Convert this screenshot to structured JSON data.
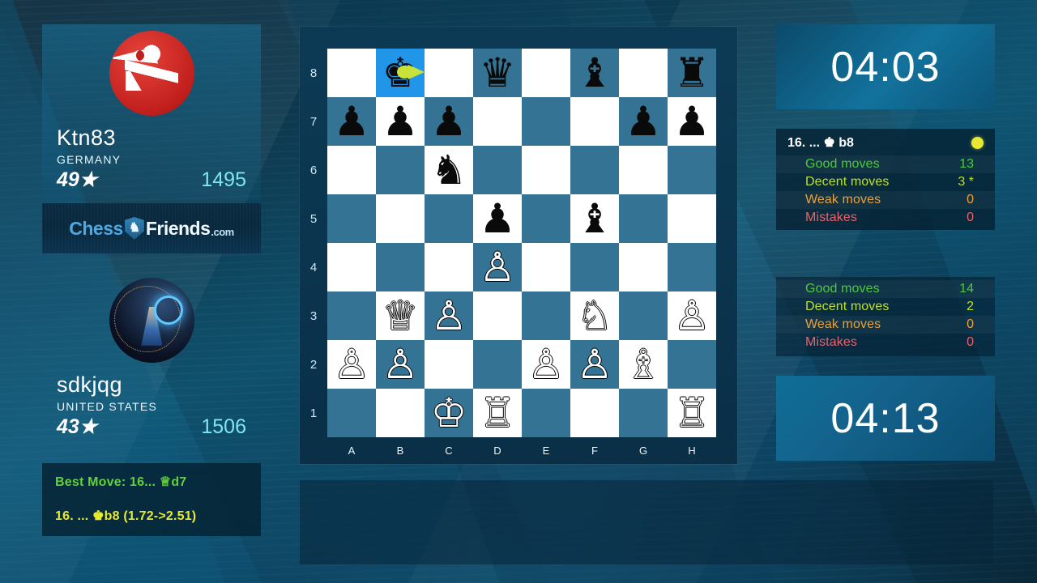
{
  "site": {
    "logo_chess": "Chess",
    "logo_friends": "Friends",
    "logo_com": ".com",
    "shield_icon": "knight-icon",
    "shield_glyph": "♞"
  },
  "players": {
    "black": {
      "name": "Ktn83",
      "country": "GERMANY",
      "stars": "49★",
      "rating": "1495",
      "avatar_name": "avatar-ktn83",
      "clock": "04:03"
    },
    "white": {
      "name": "sdkjqg",
      "country": "UNITED STATES",
      "stars": "43★",
      "rating": "1506",
      "avatar_name": "avatar-sdkjqg",
      "clock": "04:13"
    }
  },
  "analysis": {
    "best_move": "Best Move: 16... ♕d7",
    "eval_line": "16. ... ♚b8 (1.72->2.51)",
    "black_header": "16. ... ♚ b8",
    "indicator_color": "#e8e832",
    "black_stats": [
      {
        "label": "Good moves",
        "value": "13",
        "color": "#4ec93a",
        "cls": "c-good"
      },
      {
        "label": "Decent moves",
        "value": "3 *",
        "color": "#bfe02a",
        "cls": "c-decent"
      },
      {
        "label": "Weak moves",
        "value": "0",
        "color": "#e8a23a",
        "cls": "c-weak"
      },
      {
        "label": "Mistakes",
        "value": "0",
        "color": "#e8636b",
        "cls": "c-mistake"
      }
    ],
    "white_stats": [
      {
        "label": "Good moves",
        "value": "14",
        "color": "#4ec93a",
        "cls": "c-good"
      },
      {
        "label": "Decent moves",
        "value": "2",
        "color": "#bfe02a",
        "cls": "c-decent"
      },
      {
        "label": "Weak moves",
        "value": "0",
        "color": "#e8a23a",
        "cls": "c-weak"
      },
      {
        "label": "Mistakes",
        "value": "0",
        "color": "#e8636b",
        "cls": "c-mistake"
      }
    ]
  },
  "board": {
    "files": [
      "A",
      "B",
      "C",
      "D",
      "E",
      "F",
      "G",
      "H"
    ],
    "ranks": [
      "8",
      "7",
      "6",
      "5",
      "4",
      "3",
      "2",
      "1"
    ],
    "light_color": "#ffffff",
    "dark_color": "#357394",
    "highlight_color": "#2196e8",
    "highlight_squares": [
      "b8"
    ],
    "arrow": {
      "from": "d8-side",
      "to": "b8",
      "color": "#c8e23c"
    },
    "pieces": [
      {
        "sq": "b8",
        "glyph": "♚",
        "side": "b",
        "name": "black-king"
      },
      {
        "sq": "d8",
        "glyph": "♛",
        "side": "b",
        "name": "black-queen"
      },
      {
        "sq": "f8",
        "glyph": "♝",
        "side": "b",
        "name": "black-bishop"
      },
      {
        "sq": "h8",
        "glyph": "♜",
        "side": "b",
        "name": "black-rook"
      },
      {
        "sq": "a7",
        "glyph": "♟",
        "side": "b",
        "name": "black-pawn"
      },
      {
        "sq": "b7",
        "glyph": "♟",
        "side": "b",
        "name": "black-pawn"
      },
      {
        "sq": "c7",
        "glyph": "♟",
        "side": "b",
        "name": "black-pawn"
      },
      {
        "sq": "g7",
        "glyph": "♟",
        "side": "b",
        "name": "black-pawn"
      },
      {
        "sq": "h7",
        "glyph": "♟",
        "side": "b",
        "name": "black-pawn"
      },
      {
        "sq": "c6",
        "glyph": "♞",
        "side": "b",
        "name": "black-knight"
      },
      {
        "sq": "d5",
        "glyph": "♟",
        "side": "b",
        "name": "black-pawn"
      },
      {
        "sq": "f5",
        "glyph": "♝",
        "side": "b",
        "name": "black-bishop"
      },
      {
        "sq": "d4",
        "glyph": "♙",
        "side": "w",
        "name": "white-pawn"
      },
      {
        "sq": "b3",
        "glyph": "♕",
        "side": "w",
        "name": "white-queen"
      },
      {
        "sq": "c3",
        "glyph": "♙",
        "side": "w",
        "name": "white-pawn"
      },
      {
        "sq": "f3",
        "glyph": "♘",
        "side": "w",
        "name": "white-knight"
      },
      {
        "sq": "h3",
        "glyph": "♙",
        "side": "w",
        "name": "white-pawn"
      },
      {
        "sq": "a2",
        "glyph": "♙",
        "side": "w",
        "name": "white-pawn"
      },
      {
        "sq": "b2",
        "glyph": "♙",
        "side": "w",
        "name": "white-pawn"
      },
      {
        "sq": "e2",
        "glyph": "♙",
        "side": "w",
        "name": "white-pawn"
      },
      {
        "sq": "f2",
        "glyph": "♙",
        "side": "w",
        "name": "white-pawn"
      },
      {
        "sq": "g2",
        "glyph": "♗",
        "side": "w",
        "name": "white-bishop"
      },
      {
        "sq": "c1",
        "glyph": "♔",
        "side": "w",
        "name": "white-king"
      },
      {
        "sq": "d1",
        "glyph": "♖",
        "side": "w",
        "name": "white-rook"
      },
      {
        "sq": "h1",
        "glyph": "♖",
        "side": "w",
        "name": "white-rook"
      }
    ]
  }
}
